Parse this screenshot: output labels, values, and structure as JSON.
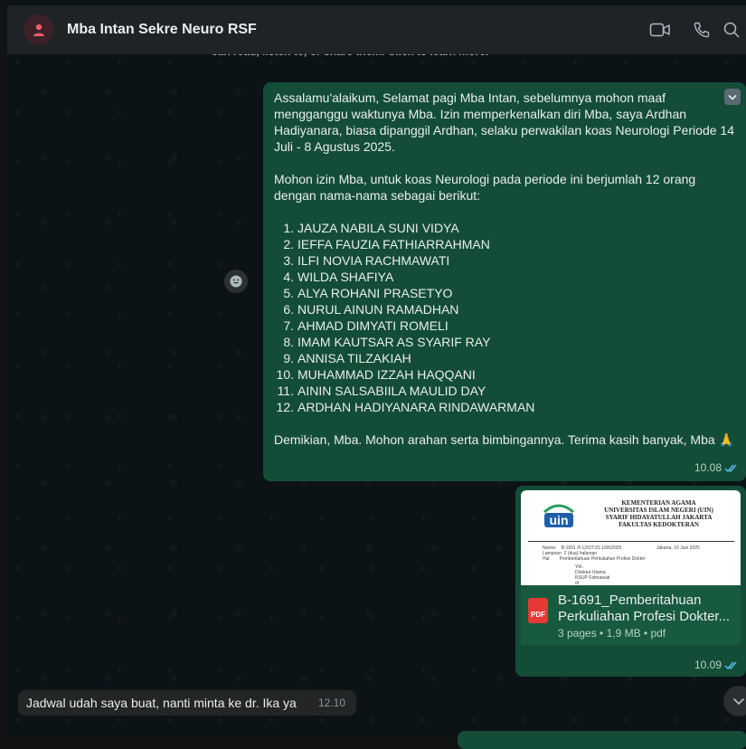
{
  "header": {
    "title": "Mba Intan Sekre Neuro RSF",
    "icons": [
      "person-icon",
      "video-call-icon",
      "phone-icon",
      "search-icon"
    ]
  },
  "banner": {
    "text": "can read, listen to, or share them. Click to learn more."
  },
  "message1": {
    "para1": "Assalamu'alaikum, Selamat pagi Mba Intan, sebelumnya mohon maaf mengganggu waktunya Mba. Izin memperkenalkan diri Mba, saya Ardhan Hadiyanara, biasa dipanggil Ardhan, selaku perwakilan koas Neurologi Periode 14 Juli - 8 Agustus  2025.",
    "para2": "Mohon izin Mba, untuk koas Neurologi pada periode ini berjumlah 12 orang dengan nama-nama sebagai berikut:",
    "list": [
      {
        "num": "1.",
        "name": "JAUZA NABILA SUNI VIDYA"
      },
      {
        "num": "2.",
        "name": "IEFFA FAUZIA FATHIARRAHMAN"
      },
      {
        "num": "3.",
        "name": "ILFI NOVIA RACHMAWATI"
      },
      {
        "num": "4.",
        "name": "WILDA SHAFIYA"
      },
      {
        "num": "5.",
        "name": "ALYA ROHANI PRASETYO"
      },
      {
        "num": "6.",
        "name": "NURUL AINUN RAMADHAN"
      },
      {
        "num": "7.",
        "name": "AHMAD DIMYATI ROMELI"
      },
      {
        "num": "8.",
        "name": "IMAM KAUTSAR AS SYARIF RAY"
      },
      {
        "num": "9.",
        "name": "ANNISA TILZAKIAH"
      },
      {
        "num": "10.",
        "name": "MUHAMMAD IZZAH HAQQANI"
      },
      {
        "num": "11.",
        "name": "AININ SALSABIILA MAULID DAY"
      },
      {
        "num": "12.",
        "name": "ARDHAN HADIYANARA RINDAWARMAN"
      }
    ],
    "para3": "Demikian, Mba. Mohon arahan serta bimbingannya. Terima kasih banyak, Mba",
    "emoji": "🙏",
    "time": "10.08",
    "status": "read"
  },
  "message2": {
    "preview": {
      "logo_text": "uin",
      "header_lines": [
        "KEMENTERIAN AGAMA",
        "UNIVERSITAS ISLAM NEGERI (UIN)",
        "SYARIF HIDAYATULLAH JAKARTA",
        "FAKULTAS KEDOKTERAN"
      ],
      "fields": [
        {
          "label": "Nomor",
          "value": "B-1691  /F.12/OT.01.1/06/2025"
        },
        {
          "label": "Lampiran",
          "value": "2 (dua) halaman"
        },
        {
          "label": "Hal",
          "value": "Pemberitahuan Perkuliahan Profesi Dokter"
        }
      ],
      "date": "Jakarta, 16 Juni 2025",
      "recipient": [
        "Yth.",
        "Direktur Utama",
        "RSUP Fatmawati",
        "di"
      ]
    },
    "doc_line1": "B-1691_Pemberitahuan",
    "doc_line2": "Perkuliahan Profesi Dokter...",
    "doc_meta": "3 pages • 1,9 MB • pdf",
    "pdf_label": "PDF",
    "time": "10.09",
    "status": "read"
  },
  "message3": {
    "text": "Jadwal udah saya buat, nanti minta ke dr. Ika ya",
    "time": "12.10"
  },
  "colors": {
    "outgoing": "#144d37",
    "incoming": "#242626",
    "read_tick": "#53bdeb",
    "avatar_accent": "#f15c6d"
  }
}
